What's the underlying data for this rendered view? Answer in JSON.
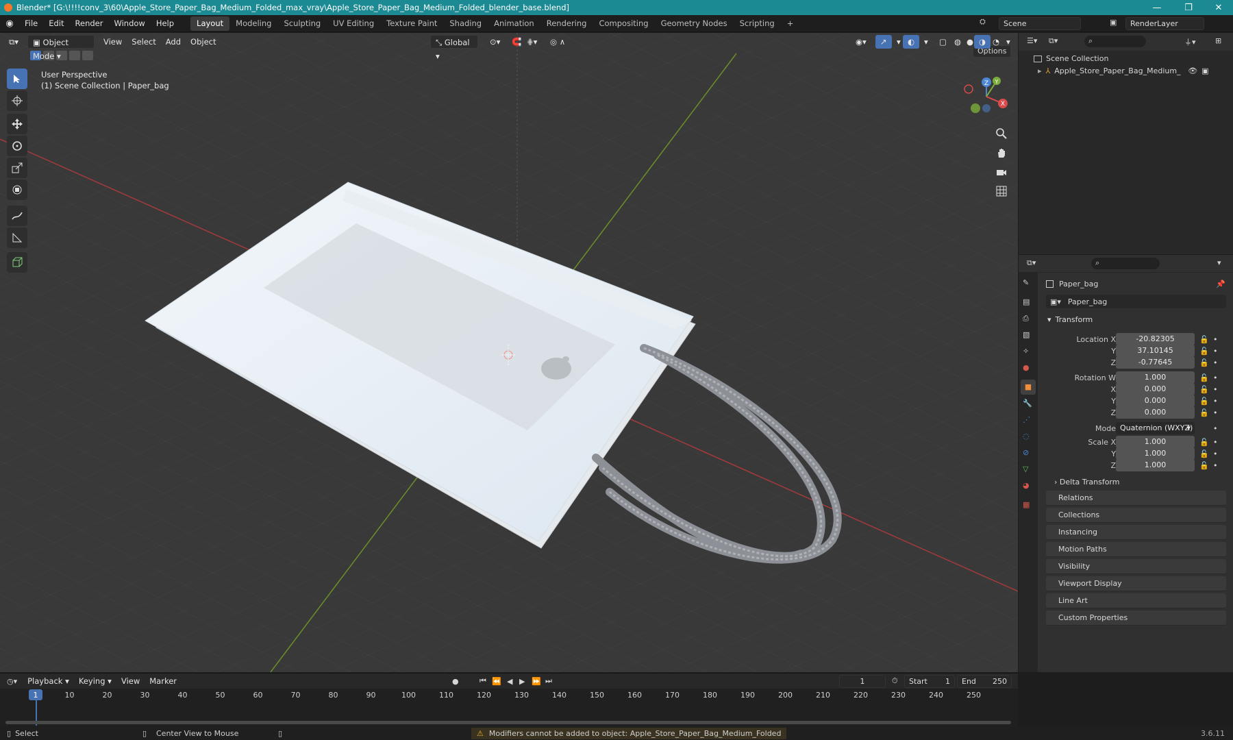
{
  "titlebar": {
    "title": "Blender* [G:\\!!!!conv_3\\60\\Apple_Store_Paper_Bag_Medium_Folded_max_vray\\Apple_Store_Paper_Bag_Medium_Folded_blender_base.blend]",
    "minimize": "—",
    "maximize": "❐",
    "close": "✕"
  },
  "menu": {
    "items": [
      "File",
      "Edit",
      "Render",
      "Window",
      "Help"
    ],
    "workspaces": [
      "Layout",
      "Modeling",
      "Sculpting",
      "UV Editing",
      "Texture Paint",
      "Shading",
      "Animation",
      "Rendering",
      "Compositing",
      "Geometry Nodes",
      "Scripting"
    ],
    "active_workspace": "Layout",
    "add_workspace": "+",
    "scene": "Scene",
    "render_layer": "RenderLayer"
  },
  "viewport_header": {
    "mode": "Object Mode",
    "menus": [
      "View",
      "Select",
      "Add",
      "Object"
    ],
    "orientation": "Global",
    "options": "Options"
  },
  "viewport": {
    "perspective": "User Perspective",
    "collection_info": "(1) Scene Collection | Paper_bag",
    "gizmo": {
      "x": "X",
      "y": "Y",
      "z": "Z"
    }
  },
  "outliner": {
    "root": "Scene Collection",
    "items": [
      {
        "label": "Apple_Store_Paper_Bag_Medium_Folded"
      }
    ]
  },
  "properties": {
    "object_name": "Paper_bag",
    "data_name": "Paper_bag",
    "transform_label": "Transform",
    "location": {
      "label": "Location X",
      "x": "-20.82305",
      "y": "37.10145",
      "z": "-0.77645"
    },
    "rotation": {
      "label": "Rotation W",
      "w": "1.000",
      "x": "0.000",
      "y": "0.000",
      "z": "0.000"
    },
    "mode_label": "Mode",
    "mode_value": "Quaternion (WXYZ)",
    "scale": {
      "label": "Scale X",
      "x": "1.000",
      "y": "1.000",
      "z": "1.000"
    },
    "axis_labels": {
      "y": "Y",
      "z": "Z",
      "x": "X"
    },
    "delta": "Delta Transform",
    "panels": [
      "Relations",
      "Collections",
      "Instancing",
      "Motion Paths",
      "Visibility",
      "Viewport Display",
      "Line Art",
      "Custom Properties"
    ]
  },
  "timeline": {
    "menus": [
      "Playback",
      "Keying",
      "View",
      "Marker"
    ],
    "current_frame": "1",
    "start_label": "Start",
    "start": "1",
    "end_label": "End",
    "end": "250",
    "ruler": [
      "1",
      "10",
      "20",
      "30",
      "40",
      "50",
      "60",
      "70",
      "80",
      "90",
      "100",
      "110",
      "120",
      "130",
      "140",
      "150",
      "160",
      "170",
      "180",
      "190",
      "200",
      "210",
      "220",
      "230",
      "240",
      "250"
    ]
  },
  "status": {
    "select": "Select",
    "center": "Center View to Mouse",
    "warning": "Modifiers cannot be added to object: Apple_Store_Paper_Bag_Medium_Folded",
    "version": "3.6.11"
  }
}
